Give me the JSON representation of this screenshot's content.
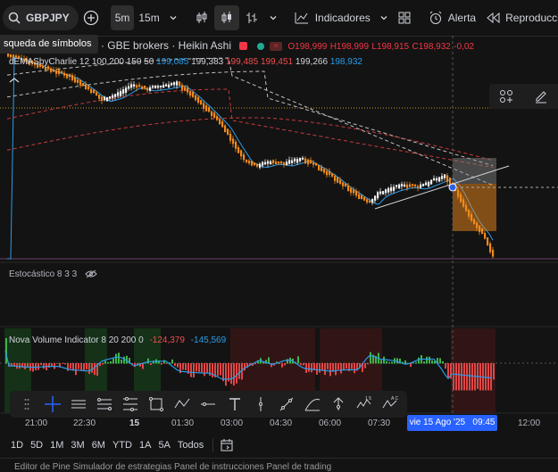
{
  "toolbar": {
    "symbol": "GBPJPY",
    "timeframes": [
      "5m",
      "15m"
    ],
    "indicators_label": "Indicadores",
    "alert_label": "Alerta",
    "replay_label": "Reproducción"
  },
  "tooltip": "squeda de símbolos",
  "legend": {
    "title": "na/Yen japonés · 5 · GBE brokers · Heikin Ashi",
    "ohlc": {
      "o": "O198,999",
      "h": "H198,999",
      "l": "L198,915",
      "c": "C198,932",
      "chg": "-0,02"
    },
    "indicator_name": "dEMASbyCharlie 12 100 200 150 50",
    "indicator_values": [
      "199,085",
      "199,383",
      "199,485",
      "199,451",
      "199,266",
      "198,932"
    ],
    "indicator_colors": [
      "#2a9ce8",
      "#d1d4dc",
      "#f04d4d",
      "#f04d4d",
      "#d1d4dc",
      "#2a9ce8"
    ]
  },
  "stoch": {
    "label": "Estocástico 8 3 3"
  },
  "nova": {
    "label": "Nova Volume Indicator 8 20 200 0",
    "v1": "-124,379",
    "v2": "-145,569"
  },
  "time_axis": {
    "labels": [
      "21:00",
      "22:30",
      "15",
      "01:30",
      "03:00",
      "04:30",
      "06:00",
      "07:30",
      "12:00"
    ],
    "crosshair_label": "vie 15 Ago '25   09:45"
  },
  "ranges": [
    "1D",
    "5D",
    "1M",
    "3M",
    "6M",
    "YTD",
    "1A",
    "5A",
    "Todos"
  ],
  "bottom_cut": "Editor de Pine    Simulador de estrategias    Panel de instrucciones    Panel de trading",
  "colors": {
    "up": "#f0f0f0",
    "down": "#f08a1c",
    "ema_fast": "#2a9ce8",
    "ema_red": "#c93a3a",
    "accent": "#2962ff"
  }
}
